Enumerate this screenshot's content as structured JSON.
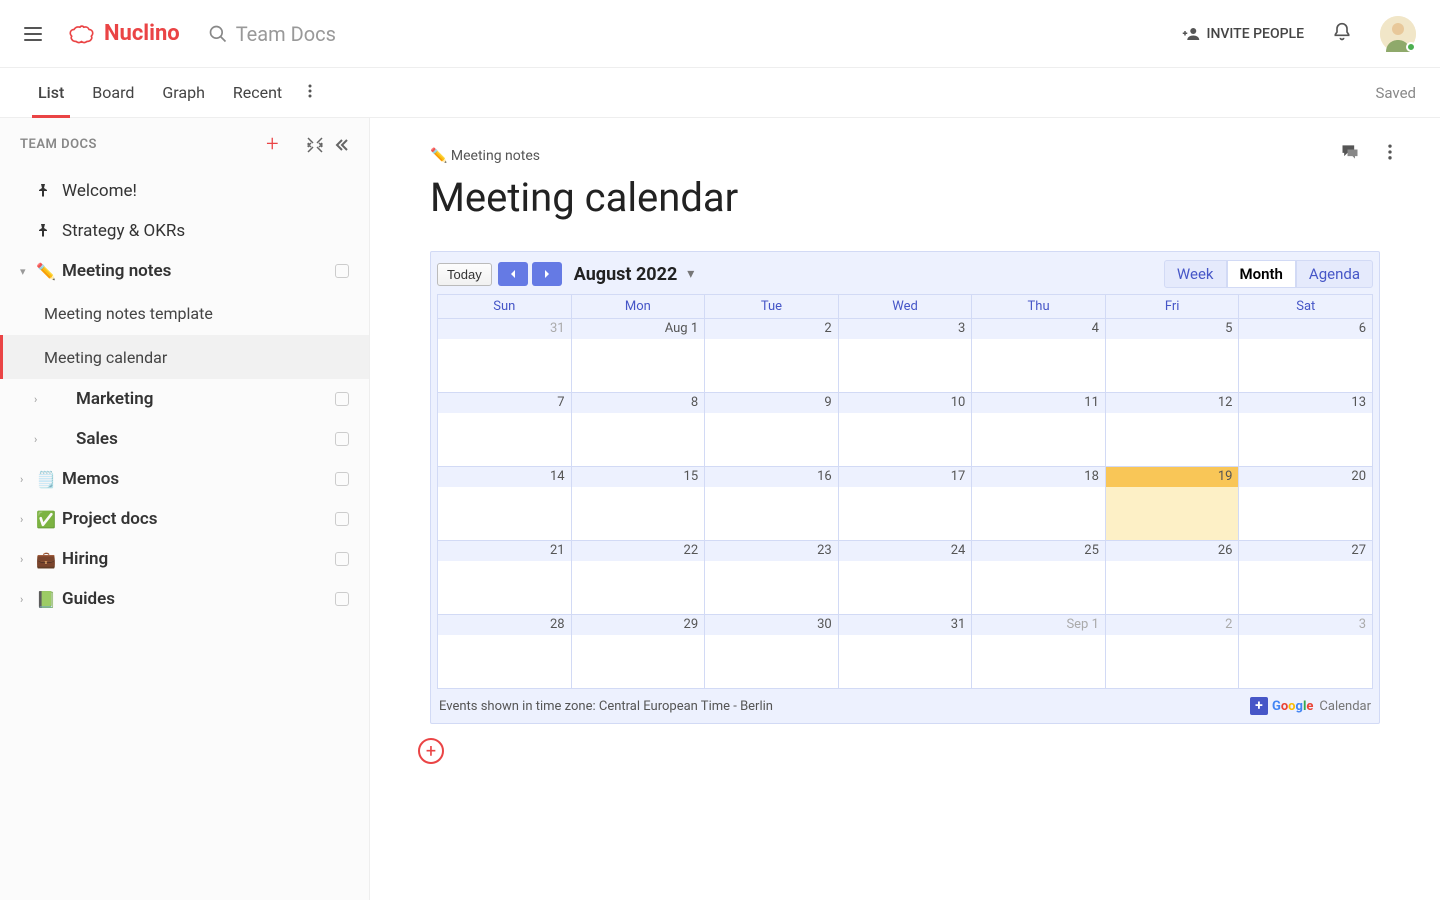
{
  "header": {
    "brand": "Nuclino",
    "search_placeholder": "Team Docs",
    "invite_label": "INVITE PEOPLE"
  },
  "tabs": {
    "items": [
      "List",
      "Board",
      "Graph",
      "Recent"
    ],
    "active_index": 0,
    "saved_label": "Saved"
  },
  "sidebar": {
    "title": "TEAM DOCS",
    "items": [
      {
        "icon": "📌",
        "label": "Welcome!",
        "pinned": true
      },
      {
        "icon": "📌",
        "label": "Strategy & OKRs",
        "pinned": true
      },
      {
        "icon": "✏️",
        "label": "Meeting notes",
        "expandable": true,
        "expanded": true,
        "bold": true,
        "children": [
          {
            "label": "Meeting notes template"
          },
          {
            "label": "Meeting calendar",
            "selected": true
          }
        ]
      },
      {
        "icon": "",
        "label": "Marketing",
        "expandable": true,
        "bold": true,
        "indent": true
      },
      {
        "icon": "",
        "label": "Sales",
        "expandable": true,
        "bold": true,
        "indent": true
      },
      {
        "icon": "🗒️",
        "label": "Memos",
        "expandable": true,
        "bold": true
      },
      {
        "icon": "✅",
        "label": "Project docs",
        "expandable": true,
        "bold": true
      },
      {
        "icon": "💼",
        "label": "Hiring",
        "expandable": true,
        "bold": true
      },
      {
        "icon": "📗",
        "label": "Guides",
        "expandable": true,
        "bold": true
      }
    ]
  },
  "doc": {
    "breadcrumb": "✏️ Meeting notes",
    "title": "Meeting calendar"
  },
  "calendar": {
    "today_label": "Today",
    "month_title": "August 2022",
    "views": [
      "Week",
      "Month",
      "Agenda"
    ],
    "active_view_index": 1,
    "dow": [
      "Sun",
      "Mon",
      "Tue",
      "Wed",
      "Thu",
      "Fri",
      "Sat"
    ],
    "weeks": [
      [
        {
          "n": "31",
          "out": true
        },
        {
          "n": "Aug 1"
        },
        {
          "n": "2"
        },
        {
          "n": "3"
        },
        {
          "n": "4"
        },
        {
          "n": "5"
        },
        {
          "n": "6"
        }
      ],
      [
        {
          "n": "7"
        },
        {
          "n": "8"
        },
        {
          "n": "9"
        },
        {
          "n": "10"
        },
        {
          "n": "11"
        },
        {
          "n": "12"
        },
        {
          "n": "13"
        }
      ],
      [
        {
          "n": "14"
        },
        {
          "n": "15"
        },
        {
          "n": "16"
        },
        {
          "n": "17"
        },
        {
          "n": "18"
        },
        {
          "n": "19",
          "today": true
        },
        {
          "n": "20"
        }
      ],
      [
        {
          "n": "21"
        },
        {
          "n": "22"
        },
        {
          "n": "23"
        },
        {
          "n": "24"
        },
        {
          "n": "25"
        },
        {
          "n": "26"
        },
        {
          "n": "27"
        }
      ],
      [
        {
          "n": "28"
        },
        {
          "n": "29"
        },
        {
          "n": "30"
        },
        {
          "n": "31"
        },
        {
          "n": "Sep 1",
          "out": true
        },
        {
          "n": "2",
          "out": true
        },
        {
          "n": "3",
          "out": true
        }
      ]
    ],
    "tz_label": "Events shown in time zone: Central European Time - Berlin",
    "gcal_word": "Google",
    "gcal_label": "Calendar"
  }
}
